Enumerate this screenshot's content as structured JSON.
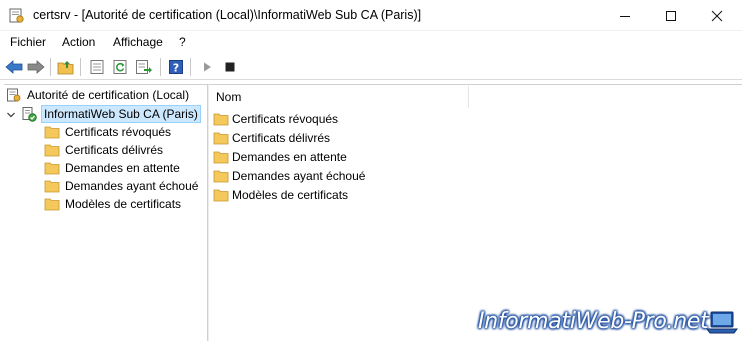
{
  "window": {
    "title": "certsrv - [Autorité de certification (Local)\\InformatiWeb Sub CA (Paris)]",
    "controls": [
      "minimize",
      "maximize",
      "close"
    ]
  },
  "menu": {
    "items": [
      "Fichier",
      "Action",
      "Affichage",
      "?"
    ]
  },
  "toolbar": {
    "buttons": [
      "back-arrow-icon",
      "forward-arrow-icon",
      "up-folder-icon",
      "properties-icon",
      "refresh-icon",
      "export-list-icon",
      "help-icon",
      "start-service-icon",
      "stop-service-icon"
    ]
  },
  "tree": {
    "root": {
      "label": "Autorité de certification (Local)",
      "icon": "certificate-authority-icon"
    },
    "ca": {
      "label": "InformatiWeb Sub CA (Paris)",
      "icon": "ca-server-icon",
      "expanded": true,
      "selected": true
    },
    "children": [
      {
        "label": "Certificats révoqués",
        "icon": "folder-icon"
      },
      {
        "label": "Certificats délivrés",
        "icon": "folder-icon"
      },
      {
        "label": "Demandes en attente",
        "icon": "folder-icon"
      },
      {
        "label": "Demandes ayant échoué",
        "icon": "folder-icon"
      },
      {
        "label": "Modèles de certificats",
        "icon": "folder-icon"
      }
    ]
  },
  "list": {
    "column": "Nom",
    "items": [
      {
        "label": "Certificats révoqués",
        "icon": "folder-icon"
      },
      {
        "label": "Certificats délivrés",
        "icon": "folder-icon"
      },
      {
        "label": "Demandes en attente",
        "icon": "folder-icon"
      },
      {
        "label": "Demandes ayant échoué",
        "icon": "folder-icon"
      },
      {
        "label": "Modèles de certificats",
        "icon": "folder-icon"
      }
    ]
  },
  "watermark": {
    "text": "InformatiWeb-Pro.net"
  },
  "colors": {
    "folder": "#f5c85c",
    "selection": "#cce8ff",
    "toolbar_accent": "#2f63b8"
  }
}
